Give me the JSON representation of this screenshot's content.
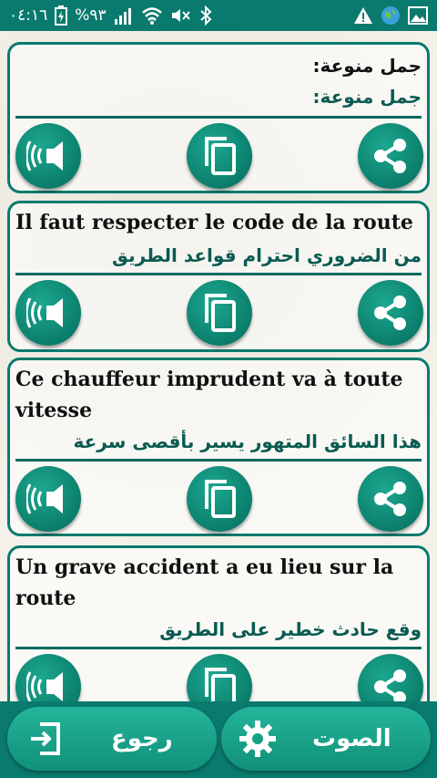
{
  "status_bar": {
    "time": "٠٤:١٦",
    "battery": "%٩٣",
    "icons": [
      "battery-icon",
      "signal-icon",
      "wifi-icon",
      "mute-icon",
      "bluetooth-icon",
      "warning-icon",
      "globe-icon",
      "gallery-icon"
    ]
  },
  "cards": [
    {
      "french": "جمل منوعة:",
      "arabic": "جمل منوعة:"
    },
    {
      "french": "Il faut respecter le code de la route",
      "arabic": "من الضروري احترام قواعد الطريق"
    },
    {
      "french": "Ce chauffeur imprudent va à toute vitesse",
      "arabic": "هذا السائق المتهور يسير بأقصى سرعة"
    },
    {
      "french": "Un grave accident a eu lieu sur la route",
      "arabic": "وقع حادث خطير على الطريق"
    }
  ],
  "actions": {
    "speak_icon": "speaker-icon",
    "copy_icon": "copy-icon",
    "share_icon": "share-icon"
  },
  "bottom": {
    "back_label": "رجوع",
    "sound_label": "الصوت"
  },
  "colors": {
    "primary": "#0a7a6e",
    "button": "#129a82",
    "arabic_text": "#0a5b52"
  }
}
